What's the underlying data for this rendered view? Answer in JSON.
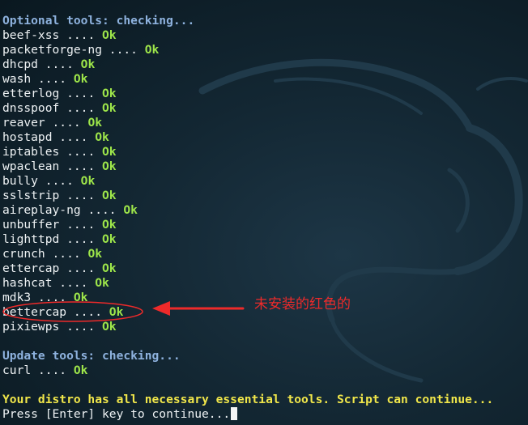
{
  "optional_header": "Optional tools: checking...",
  "separator": " .... ",
  "optional_tools": [
    {
      "name": "beef-xss",
      "status": "Ok"
    },
    {
      "name": "packetforge-ng",
      "status": "Ok"
    },
    {
      "name": "dhcpd",
      "status": "Ok"
    },
    {
      "name": "wash",
      "status": "Ok"
    },
    {
      "name": "etterlog",
      "status": "Ok"
    },
    {
      "name": "dnsspoof",
      "status": "Ok"
    },
    {
      "name": "reaver",
      "status": "Ok"
    },
    {
      "name": "hostapd",
      "status": "Ok"
    },
    {
      "name": "iptables",
      "status": "Ok"
    },
    {
      "name": "wpaclean",
      "status": "Ok"
    },
    {
      "name": "bully",
      "status": "Ok"
    },
    {
      "name": "sslstrip",
      "status": "Ok"
    },
    {
      "name": "aireplay-ng",
      "status": "Ok"
    },
    {
      "name": "unbuffer",
      "status": "Ok"
    },
    {
      "name": "lighttpd",
      "status": "Ok"
    },
    {
      "name": "crunch",
      "status": "Ok"
    },
    {
      "name": "ettercap",
      "status": "Ok"
    },
    {
      "name": "hashcat",
      "status": "Ok"
    },
    {
      "name": "mdk3",
      "status": "Ok"
    },
    {
      "name": "bettercap",
      "status": "Ok"
    },
    {
      "name": "pixiewps",
      "status": "Ok"
    }
  ],
  "update_header": "Update tools: checking...",
  "update_tools": [
    {
      "name": "curl",
      "status": "Ok"
    }
  ],
  "final_message": "Your distro has all necessary essential tools. Script can continue...",
  "prompt": "Press [Enter] key to continue...",
  "annotation_text": "未安装的红色的",
  "colors": {
    "header": "#8eb2de",
    "ok": "#9ee64a",
    "warning": "#f0e64a",
    "annotation": "#ee2a2a",
    "background": "#132733"
  }
}
